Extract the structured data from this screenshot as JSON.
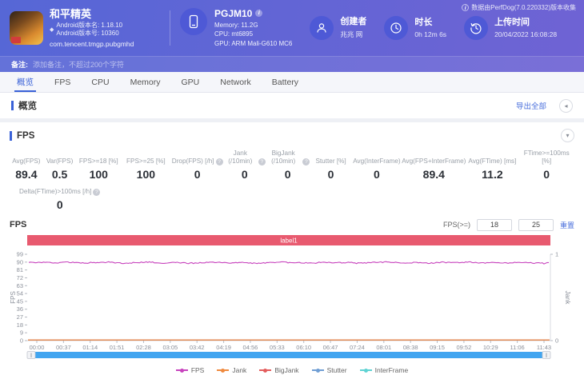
{
  "header": {
    "app": {
      "title": "和平精英",
      "version_name": "Android版本名: 1.18.10",
      "version_code": "Android版本号: 10360",
      "package": "com.tencent.tmgp.pubgmhd"
    },
    "device": {
      "name": "PGJM10",
      "memory": "Memory: 11.2G",
      "cpu": "CPU: mt6895",
      "gpu": "GPU: ARM Mali-G610 MC6"
    },
    "creator": {
      "label": "创建者",
      "value": "兆兆 网"
    },
    "duration": {
      "label": "时长",
      "value": "0h 12m 6s"
    },
    "upload": {
      "label": "上传时间",
      "value": "20/04/2022 16:08:28"
    },
    "collector_note": "数据由PerfDog(7.0.220332)版本收集",
    "note": {
      "label": "备注:",
      "placeholder": "添加备注，不超过200个字符"
    }
  },
  "tabs": {
    "items": [
      "概览",
      "FPS",
      "CPU",
      "Memory",
      "GPU",
      "Network",
      "Battery"
    ],
    "active_index": 0
  },
  "overview": {
    "title": "概览",
    "export_label": "导出全部"
  },
  "fps_section": {
    "title": "FPS",
    "stats": [
      {
        "label": "Avg(FPS)",
        "value": "89.4",
        "info": false
      },
      {
        "label": "Var(FPS)",
        "value": "0.5",
        "info": false
      },
      {
        "label": "FPS>=18 [%]",
        "value": "100",
        "info": false
      },
      {
        "label": "FPS>=25 [%]",
        "value": "100",
        "info": false
      },
      {
        "label": "Drop(FPS) [/h]",
        "value": "0",
        "info": true
      },
      {
        "label": "Jank (/10min)",
        "value": "0",
        "info": true
      },
      {
        "label": "BigJank (/10min)",
        "value": "0",
        "info": true
      },
      {
        "label": "Stutter [%]",
        "value": "0",
        "info": false
      },
      {
        "label": "Avg(InterFrame)",
        "value": "0",
        "info": false
      },
      {
        "label": "Avg(FPS+InterFrame)",
        "value": "89.4",
        "info": false
      },
      {
        "label": "Avg(FTime) [ms]",
        "value": "11.2",
        "info": false
      },
      {
        "label": "FTime>=100ms [%]",
        "value": "0",
        "info": false
      }
    ],
    "stats_row2": {
      "label": "Delta(FTime)>100ms [/h]",
      "value": "0",
      "info": true
    },
    "chart_controls": {
      "label": "FPS(>=)",
      "threshold1": "18",
      "threshold2": "25",
      "reset_label": "重置"
    }
  },
  "chart_data": {
    "type": "line",
    "title": "FPS",
    "annotation_band": {
      "label": "label1",
      "color": "#e85a6f"
    },
    "x_ticks": [
      "00:00",
      "00:37",
      "01:14",
      "01:51",
      "02:28",
      "03:05",
      "03:42",
      "04:19",
      "04:56",
      "05:33",
      "06:10",
      "06:47",
      "07:24",
      "08:01",
      "08:38",
      "09:15",
      "09:52",
      "10:29",
      "11:06",
      "11:43"
    ],
    "y_left": {
      "label": "FPS",
      "min": 0,
      "max": 99,
      "ticks": [
        0,
        9,
        18,
        27,
        36,
        45,
        54,
        63,
        72,
        81,
        90,
        99
      ]
    },
    "y_right": {
      "label": "Jank",
      "min": 0,
      "max": 1,
      "ticks": [
        0,
        1
      ]
    },
    "series": [
      {
        "name": "FPS",
        "color": "#c743bd",
        "axis": "left",
        "values": [
          89.5,
          89.8,
          89.2,
          90.0,
          88.9,
          89.6,
          89.9,
          88.7,
          89.4,
          90.1,
          89.0,
          89.7,
          88.8,
          89.5,
          90.0,
          89.1,
          89.8,
          88.6,
          89.3,
          89.9,
          89.4,
          88.9,
          90.0,
          89.2,
          89.6,
          88.8,
          89.7,
          90.1,
          89.0,
          89.5,
          88.7,
          89.9,
          89.3,
          90.0,
          88.9,
          89.6,
          89.1,
          89.8,
          88.8,
          89.4
        ]
      },
      {
        "name": "Jank",
        "color": "#ef8a3f",
        "axis": "right",
        "constant": 0
      },
      {
        "name": "BigJank",
        "color": "#e35d5d",
        "axis": "right",
        "constant": 0
      },
      {
        "name": "Stutter",
        "color": "#6f9ed4",
        "axis": "left",
        "constant": 0
      },
      {
        "name": "InterFrame",
        "color": "#5fd3d3",
        "axis": "left",
        "constant": 0
      }
    ],
    "legend": [
      "FPS",
      "Jank",
      "BigJank",
      "Stutter",
      "InterFrame"
    ],
    "legend_position": "bottom",
    "grid": false
  }
}
